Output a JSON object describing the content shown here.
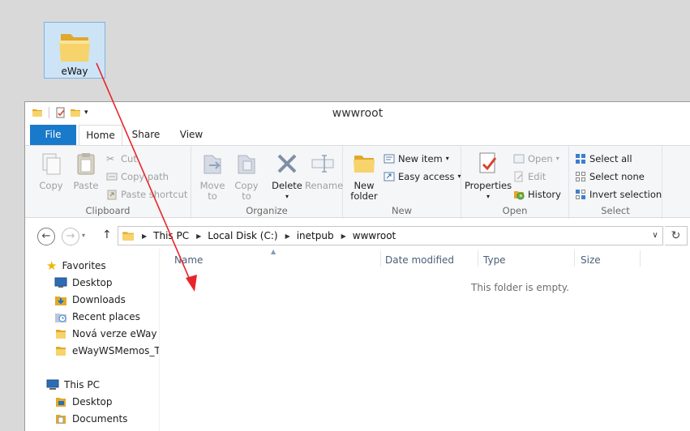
{
  "desktop": {
    "icon_label": "eWay"
  },
  "window": {
    "title": "wwwroot",
    "tabs": [
      "File",
      "Home",
      "Share",
      "View"
    ]
  },
  "ribbon": {
    "clipboard": {
      "name": "Clipboard",
      "copy": "Copy",
      "paste": "Paste",
      "cut": "Cut",
      "copy_path": "Copy path",
      "paste_shortcut": "Paste shortcut"
    },
    "organize": {
      "name": "Organize",
      "move_to": [
        "Move",
        "to"
      ],
      "copy_to": [
        "Copy",
        "to"
      ],
      "delete": "Delete",
      "rename": "Rename"
    },
    "new": {
      "name": "New",
      "new_folder": [
        "New",
        "folder"
      ],
      "new_item": "New item",
      "easy_access": "Easy access"
    },
    "open": {
      "name": "Open",
      "properties": "Properties",
      "open": "Open",
      "edit": "Edit",
      "history": "History"
    },
    "select": {
      "name": "Select",
      "select_all": "Select all",
      "select_none": "Select none",
      "invert": "Invert selection"
    }
  },
  "address": {
    "crumbs": [
      "This PC",
      "Local Disk (C:)",
      "inetpub",
      "wwwroot"
    ]
  },
  "nav": {
    "favorites": "Favorites",
    "fav_items": [
      "Desktop",
      "Downloads",
      "Recent places",
      "Nová verze eWay",
      "eWayWSMemos_Tes"
    ],
    "this_pc": "This PC",
    "pc_items": [
      "Desktop",
      "Documents"
    ]
  },
  "columns": [
    "Name",
    "Date modified",
    "Type",
    "Size"
  ],
  "empty_message": "This folder is empty.",
  "colors": {
    "accent": "#1979ca",
    "arrow": "#e8252b",
    "folder": "#f2c14e"
  }
}
